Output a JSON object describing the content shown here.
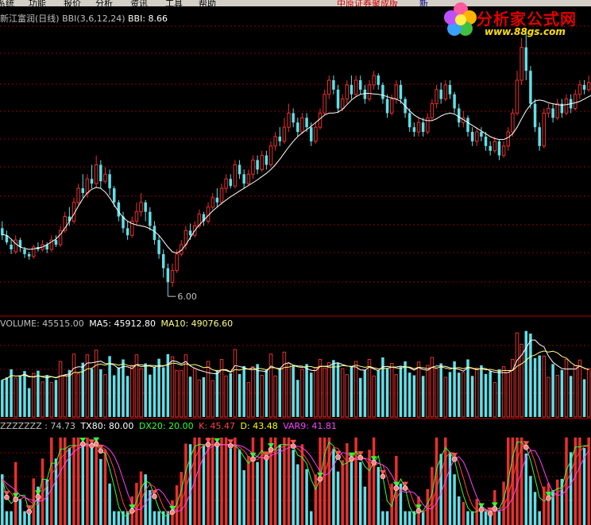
{
  "menu": {
    "items": [
      "系统",
      "功能",
      "报价",
      "分析",
      "资讯",
      "工具",
      "帮助"
    ],
    "promo": "中原证券聚成版",
    "extra": "新"
  },
  "logo": {
    "title": "分析家公式网",
    "url": "www.88gs.com"
  },
  "colors": {
    "up": "#e8302c",
    "down": "#5fe0e8",
    "bbi": "#ffffff",
    "ma10": "#ffff80",
    "tx80": "#ffffff",
    "dx20": "#33ff33",
    "k": "#ff4444",
    "d": "#ffff00",
    "var9": "#ff40ff",
    "grid": "#8b0000"
  },
  "price_panel": {
    "legend": {
      "name": "新江富润(日线)",
      "indicator": "BBI(3,6,12,24)",
      "value_label": "BBI: 8.66"
    },
    "low_marker": "6.00"
  },
  "volume_panel": {
    "legend": {
      "volume": "VOLUME: 45515.00",
      "ma5": "MA5: 45912.80",
      "ma10": "MA10: 49076.60"
    }
  },
  "osc_panel": {
    "legend": {
      "zz": "ZZZZZZZ : 74.73",
      "tx80": "TX80: 80.00",
      "dx20": "DX20: 20.00",
      "k": "K: 45.47",
      "d": "D: 43.48",
      "var9": "VAR9: 41.81"
    }
  },
  "chart_data": [
    {
      "type": "candlestick",
      "title": "新江富润(日线)",
      "indicator": "BBI(3,6,12,24)",
      "bbi_last": 8.66,
      "annotation_low": 6.0,
      "ylim": [
        5.8,
        11.8
      ],
      "grid": true,
      "series": [
        {
          "name": "BBI(3,6,12,24)",
          "values": [
            7.32,
            7.3,
            7.22,
            7.12,
            7.05,
            7.02,
            7.0,
            7.01,
            7.03,
            7.05,
            7.1,
            7.16,
            7.22,
            7.32,
            7.45,
            7.6,
            7.75,
            7.92,
            8.08,
            8.2,
            8.28,
            8.32,
            8.3,
            8.22,
            8.1,
            7.95,
            7.8,
            7.68,
            7.6,
            7.55,
            7.52,
            7.5,
            7.48,
            7.44,
            7.38,
            7.3,
            7.18,
            7.05,
            6.95,
            6.92,
            6.98,
            7.1,
            7.25,
            7.4,
            7.52,
            7.62,
            7.72,
            7.82,
            7.9,
            7.98,
            8.05,
            8.12,
            8.18,
            8.24,
            8.3,
            8.36,
            8.42,
            8.48,
            8.55,
            8.62,
            8.7,
            8.8,
            8.92,
            9.05,
            9.18,
            9.3,
            9.4,
            9.48,
            9.55,
            9.62,
            9.7,
            9.78,
            9.86,
            9.9,
            9.9,
            9.92,
            9.98,
            10.08,
            10.18,
            10.25,
            10.3,
            10.32,
            10.32,
            10.31,
            10.3,
            10.28,
            10.25,
            10.22,
            10.2,
            10.15,
            10.05,
            9.95,
            9.86,
            9.8,
            9.76,
            9.74,
            9.74,
            9.78,
            9.84,
            9.88,
            9.9,
            9.88,
            9.82,
            9.76,
            9.7,
            9.64,
            9.58,
            9.52,
            9.46,
            9.4,
            9.36,
            9.34,
            9.34,
            9.38,
            9.46,
            9.6,
            9.78,
            9.95,
            10.08,
            10.16,
            10.18,
            10.16,
            10.12,
            10.1,
            10.08,
            10.07,
            10.08,
            10.1,
            10.12,
            10.15,
            10.2,
            10.25,
            10.3
          ]
        }
      ],
      "candles": [
        [
          7.45,
          7.3,
          7.6,
          7.2
        ],
        [
          7.3,
          7.15,
          7.4,
          7.1
        ],
        [
          7.1,
          7.0,
          7.2,
          6.9
        ],
        [
          6.95,
          7.2,
          7.3,
          6.9
        ],
        [
          7.2,
          7.05,
          7.25,
          6.95
        ],
        [
          7.0,
          6.9,
          7.05,
          6.82
        ],
        [
          6.9,
          6.85,
          6.95,
          6.78
        ],
        [
          6.85,
          7.05,
          7.1,
          6.8
        ],
        [
          7.05,
          7.0,
          7.15,
          6.95
        ],
        [
          7.0,
          7.1,
          7.2,
          6.95
        ],
        [
          7.1,
          7.0,
          7.15,
          6.92
        ],
        [
          7.0,
          7.2,
          7.3,
          6.95
        ],
        [
          7.2,
          7.1,
          7.3,
          7.05
        ],
        [
          7.1,
          7.4,
          7.5,
          7.05
        ],
        [
          7.4,
          7.7,
          7.8,
          7.35
        ],
        [
          7.7,
          7.6,
          7.9,
          7.5
        ],
        [
          7.6,
          8.0,
          8.1,
          7.55
        ],
        [
          8.0,
          8.3,
          8.4,
          7.95
        ],
        [
          8.3,
          8.2,
          8.6,
          8.1
        ],
        [
          8.2,
          8.5,
          8.6,
          8.1
        ],
        [
          8.5,
          8.4,
          8.8,
          8.3
        ],
        [
          8.4,
          8.8,
          9.0,
          8.3
        ],
        [
          8.8,
          8.45,
          8.9,
          8.3
        ],
        [
          8.45,
          8.6,
          8.75,
          8.4
        ],
        [
          8.6,
          8.3,
          8.7,
          8.15
        ],
        [
          8.3,
          8.0,
          8.35,
          7.9
        ],
        [
          8.0,
          7.7,
          8.05,
          7.6
        ],
        [
          7.7,
          7.45,
          7.8,
          7.35
        ],
        [
          7.45,
          7.3,
          7.6,
          7.2
        ],
        [
          7.3,
          7.6,
          7.7,
          7.25
        ],
        [
          7.6,
          7.8,
          8.0,
          7.5
        ],
        [
          7.8,
          8.0,
          8.2,
          7.7
        ],
        [
          8.0,
          7.8,
          8.05,
          7.6
        ],
        [
          7.8,
          7.5,
          7.9,
          7.4
        ],
        [
          7.5,
          7.2,
          7.6,
          7.1
        ],
        [
          7.2,
          6.9,
          7.3,
          6.8
        ],
        [
          6.9,
          6.6,
          7.0,
          6.4
        ],
        [
          6.6,
          6.3,
          6.7,
          6.0
        ],
        [
          6.3,
          6.55,
          6.7,
          6.2
        ],
        [
          6.55,
          6.9,
          7.0,
          6.5
        ],
        [
          6.9,
          7.1,
          7.2,
          6.85
        ],
        [
          7.1,
          7.4,
          7.5,
          7.0
        ],
        [
          7.4,
          7.3,
          7.55,
          7.2
        ],
        [
          7.3,
          7.5,
          7.6,
          7.25
        ],
        [
          7.5,
          7.75,
          7.85,
          7.45
        ],
        [
          7.75,
          7.6,
          7.8,
          7.5
        ],
        [
          7.6,
          7.9,
          8.0,
          7.55
        ],
        [
          7.9,
          8.1,
          8.2,
          7.85
        ],
        [
          8.1,
          8.0,
          8.3,
          7.9
        ],
        [
          8.0,
          8.3,
          8.4,
          7.95
        ],
        [
          8.3,
          8.5,
          8.6,
          8.2
        ],
        [
          8.5,
          8.35,
          8.6,
          8.3
        ],
        [
          8.35,
          8.8,
          8.9,
          8.3
        ],
        [
          8.8,
          8.6,
          8.9,
          8.5
        ],
        [
          8.6,
          8.4,
          8.7,
          8.3
        ],
        [
          8.4,
          8.6,
          8.7,
          8.35
        ],
        [
          8.6,
          8.9,
          9.0,
          8.5
        ],
        [
          8.9,
          8.7,
          9.0,
          8.6
        ],
        [
          8.7,
          9.0,
          9.1,
          8.65
        ],
        [
          9.0,
          8.8,
          9.1,
          8.7
        ],
        [
          8.8,
          9.2,
          9.3,
          8.75
        ],
        [
          9.2,
          9.4,
          9.5,
          9.1
        ],
        [
          9.4,
          9.3,
          9.6,
          9.2
        ],
        [
          9.3,
          9.6,
          9.8,
          9.25
        ],
        [
          9.6,
          9.9,
          10.1,
          9.5
        ],
        [
          9.9,
          9.7,
          10.0,
          9.6
        ],
        [
          9.7,
          9.5,
          9.8,
          9.4
        ],
        [
          9.5,
          9.8,
          9.9,
          9.45
        ],
        [
          9.8,
          9.6,
          9.9,
          9.5
        ],
        [
          9.6,
          9.3,
          9.7,
          9.2
        ],
        [
          9.3,
          9.6,
          9.7,
          9.25
        ],
        [
          9.6,
          9.9,
          10.0,
          9.55
        ],
        [
          9.9,
          10.3,
          10.4,
          9.85
        ],
        [
          10.3,
          10.6,
          10.7,
          10.2
        ],
        [
          10.6,
          10.4,
          10.7,
          10.3
        ],
        [
          10.4,
          10.0,
          10.5,
          9.9
        ],
        [
          10.0,
          10.2,
          10.3,
          9.95
        ],
        [
          10.2,
          10.5,
          10.6,
          10.1
        ],
        [
          10.5,
          10.3,
          10.7,
          10.2
        ],
        [
          10.3,
          10.6,
          10.7,
          10.25
        ],
        [
          10.6,
          10.4,
          10.7,
          10.3
        ],
        [
          10.4,
          10.2,
          10.5,
          10.1
        ],
        [
          10.2,
          10.5,
          10.6,
          10.15
        ],
        [
          10.5,
          10.7,
          10.8,
          10.4
        ],
        [
          10.7,
          10.5,
          10.75,
          10.4
        ],
        [
          10.5,
          10.2,
          10.55,
          10.1
        ],
        [
          10.2,
          9.9,
          10.3,
          9.8
        ],
        [
          9.9,
          10.2,
          10.3,
          9.85
        ],
        [
          10.2,
          10.5,
          10.6,
          10.1
        ],
        [
          10.5,
          10.2,
          10.6,
          10.1
        ],
        [
          10.2,
          9.9,
          10.25,
          9.8
        ],
        [
          9.9,
          9.6,
          10.0,
          9.5
        ],
        [
          9.6,
          9.5,
          9.7,
          9.4
        ],
        [
          9.5,
          9.7,
          9.8,
          9.4
        ],
        [
          9.7,
          9.5,
          9.8,
          9.4
        ],
        [
          9.5,
          9.8,
          9.9,
          9.45
        ],
        [
          9.8,
          10.1,
          10.2,
          9.75
        ],
        [
          10.1,
          10.4,
          10.5,
          10.0
        ],
        [
          10.4,
          10.2,
          10.55,
          10.1
        ],
        [
          10.2,
          10.5,
          10.6,
          10.15
        ],
        [
          10.5,
          10.3,
          10.6,
          10.2
        ],
        [
          10.3,
          10.0,
          10.35,
          9.9
        ],
        [
          10.0,
          9.7,
          10.1,
          9.6
        ],
        [
          9.7,
          9.8,
          9.95,
          9.6
        ],
        [
          9.8,
          9.5,
          9.85,
          9.4
        ],
        [
          9.5,
          9.3,
          9.6,
          9.2
        ],
        [
          9.3,
          9.5,
          9.6,
          9.2
        ],
        [
          9.5,
          9.4,
          9.6,
          9.3
        ],
        [
          9.4,
          9.2,
          9.5,
          9.1
        ],
        [
          9.2,
          9.1,
          9.3,
          9.0
        ],
        [
          9.1,
          9.3,
          9.4,
          9.05
        ],
        [
          9.3,
          9.0,
          9.35,
          8.9
        ],
        [
          9.0,
          9.2,
          9.3,
          8.95
        ],
        [
          9.2,
          9.5,
          9.6,
          9.1
        ],
        [
          9.5,
          9.9,
          10.0,
          9.4
        ],
        [
          9.9,
          10.6,
          10.8,
          9.85
        ],
        [
          10.6,
          11.3,
          11.5,
          10.5
        ],
        [
          11.3,
          10.8,
          11.7,
          10.6
        ],
        [
          10.8,
          10.1,
          10.9,
          10.0
        ],
        [
          10.1,
          9.6,
          10.2,
          9.5
        ],
        [
          9.6,
          9.2,
          9.7,
          9.1
        ],
        [
          9.2,
          9.9,
          10.0,
          9.15
        ],
        [
          9.9,
          10.0,
          10.1,
          9.8
        ],
        [
          10.0,
          9.8,
          10.1,
          9.7
        ],
        [
          9.8,
          10.1,
          10.2,
          9.75
        ],
        [
          10.1,
          9.9,
          10.2,
          9.8
        ],
        [
          9.9,
          10.2,
          10.3,
          9.85
        ],
        [
          10.2,
          10.0,
          10.3,
          9.9
        ],
        [
          10.0,
          10.3,
          10.4,
          9.95
        ],
        [
          10.3,
          10.5,
          10.6,
          10.2
        ],
        [
          10.5,
          10.4,
          10.6,
          10.3
        ],
        [
          10.4,
          10.55,
          10.7,
          10.35
        ]
      ]
    },
    {
      "type": "bar",
      "title": "VOLUME",
      "values_last": {
        "VOLUME": 45515.0,
        "MA5": 45912.8,
        "MA10": 49076.6
      },
      "ylim": [
        0,
        110000
      ],
      "grid": true
    },
    {
      "type": "bar",
      "title": "ZZZZZZZ",
      "values_last": {
        "ZZZZZZZ": 74.73,
        "TX80": 80.0,
        "DX20": 20.0,
        "K": 45.47,
        "D": 43.48,
        "VAR9": 41.81
      },
      "ylim": [
        0,
        100
      ],
      "grid": true
    }
  ]
}
